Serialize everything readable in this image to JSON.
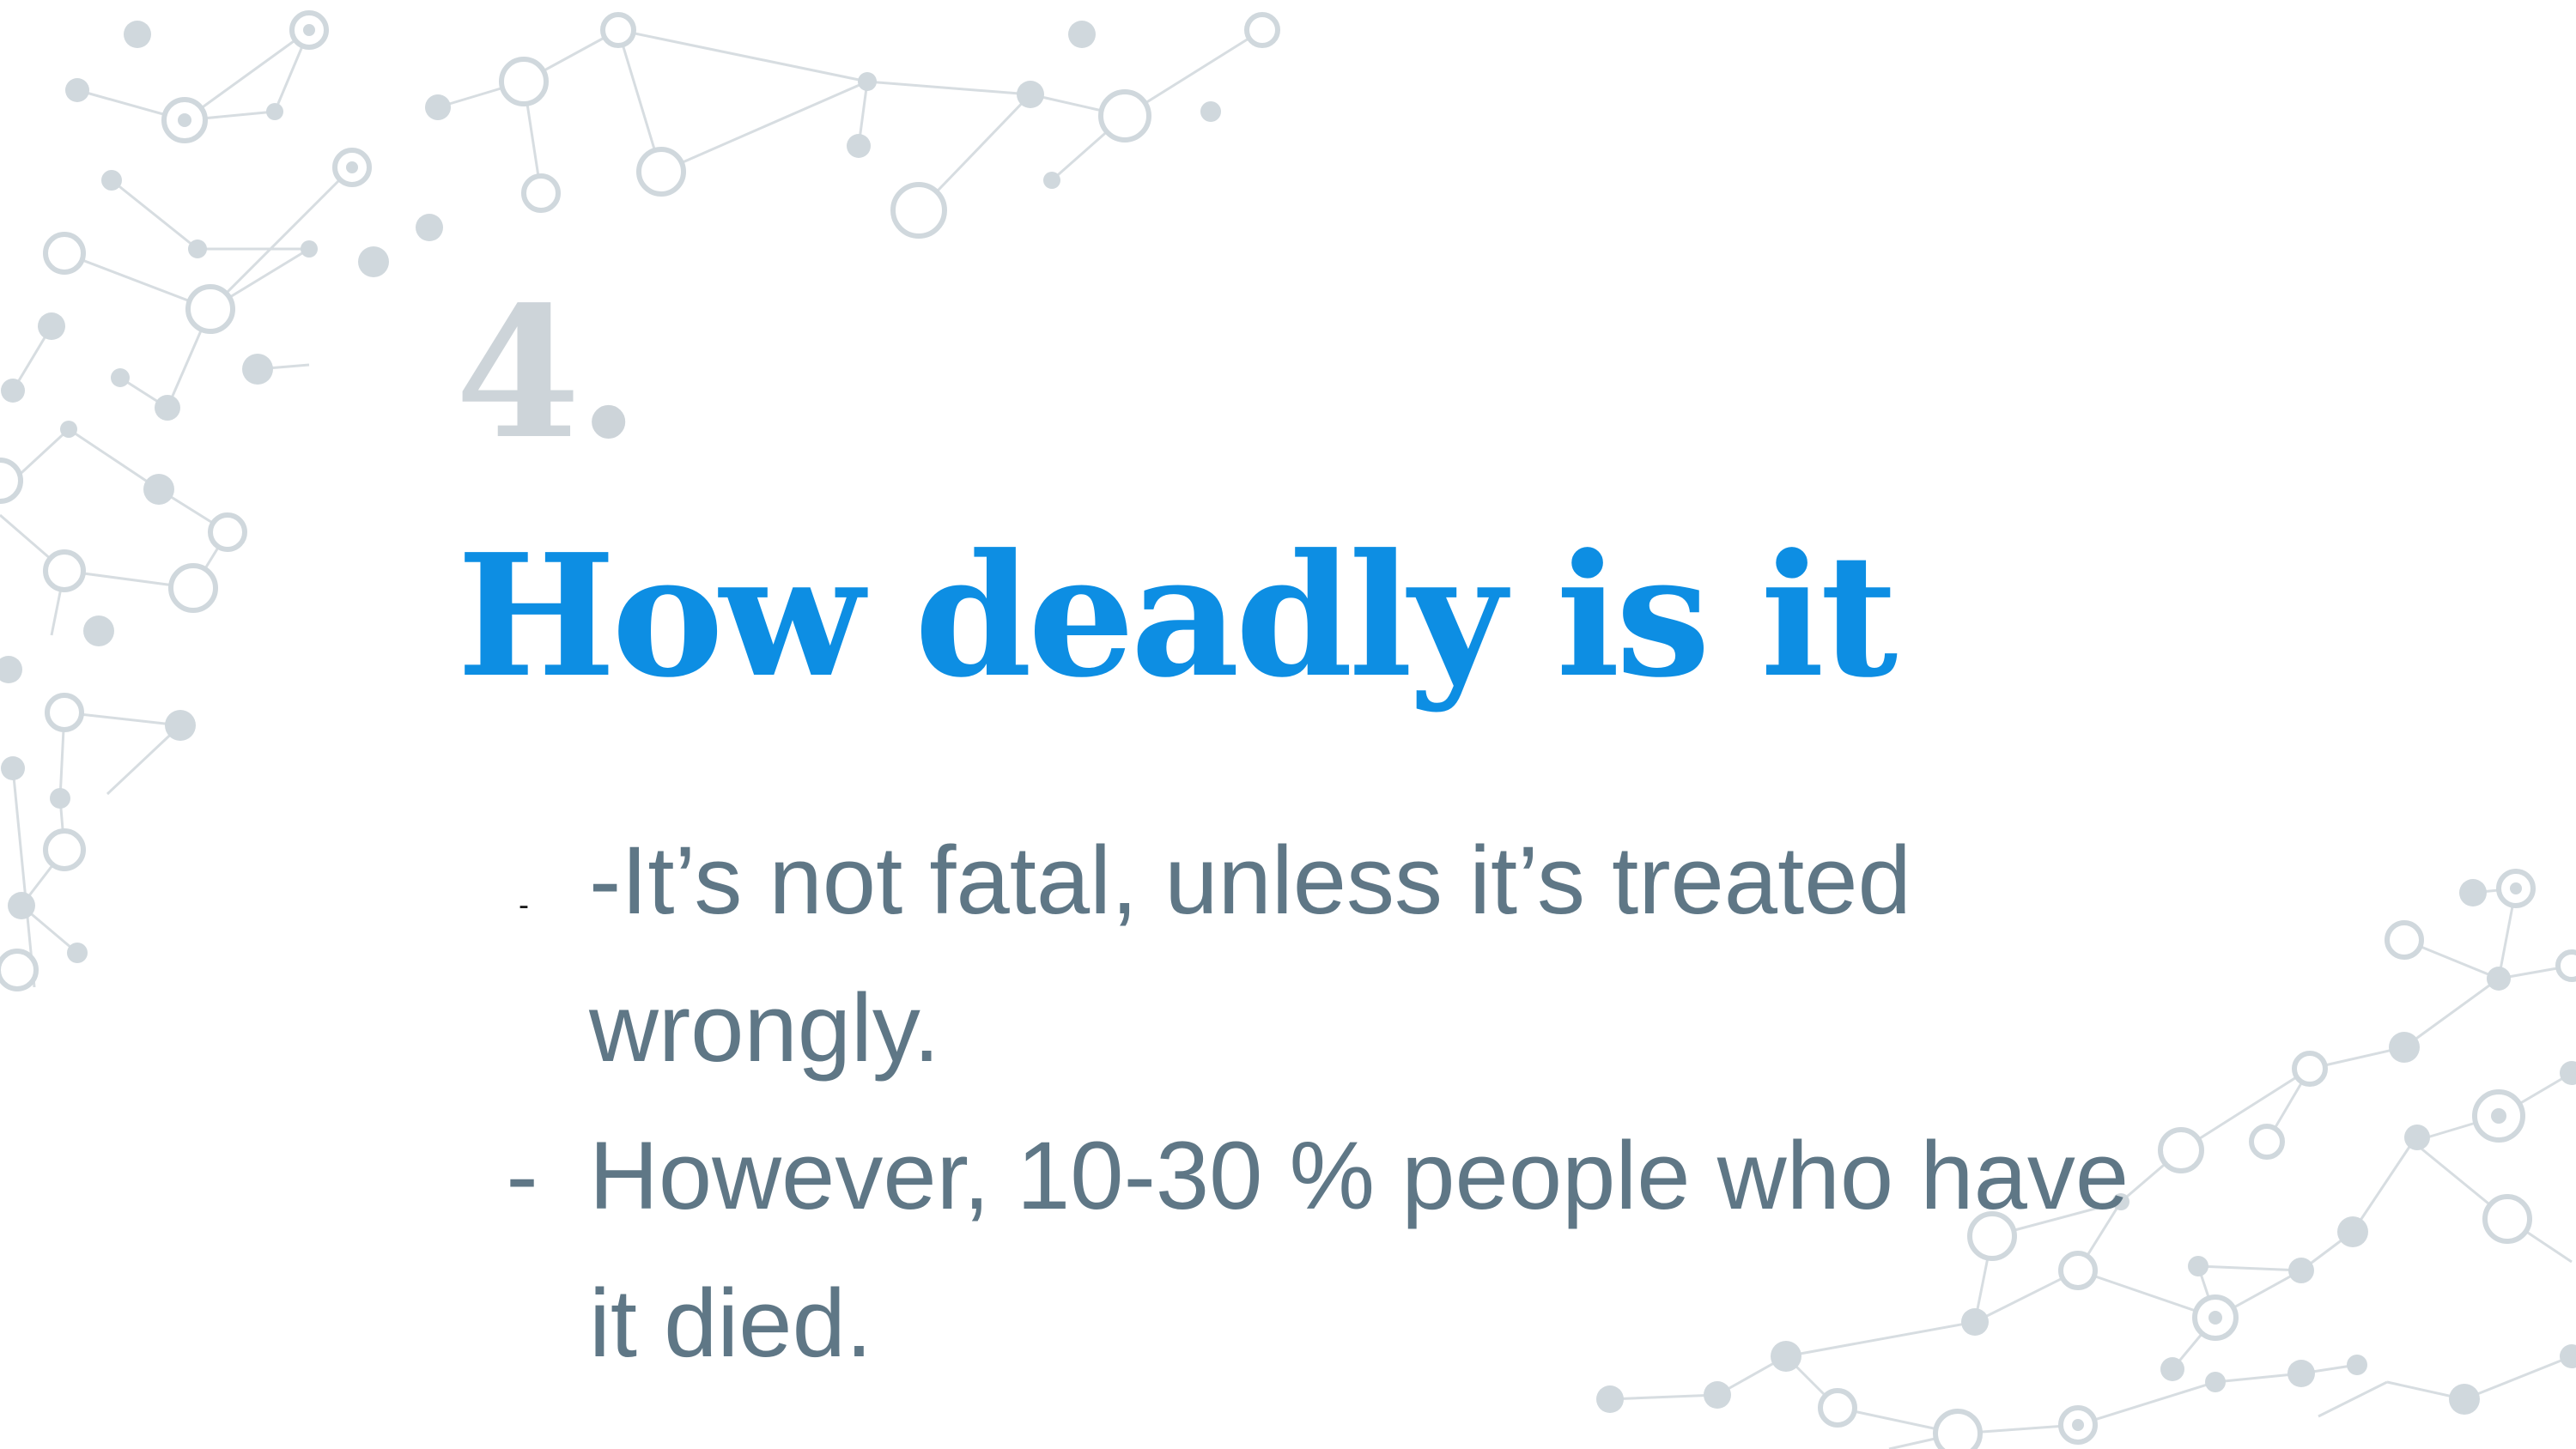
{
  "slide": {
    "section_number": "4.",
    "title": "How deadly is it",
    "bullets": [
      {
        "marker": "-",
        "text": "-It’s not fatal, unless it’s treated wrongly."
      },
      {
        "marker": "-",
        "text": "However, 10-30 % people who have it died."
      }
    ]
  },
  "colors": {
    "number": "#cdd4d9",
    "title": "#0d8ee3",
    "body_text": "#5f7786",
    "network": "#cfd6db",
    "background": "#ffffff"
  }
}
